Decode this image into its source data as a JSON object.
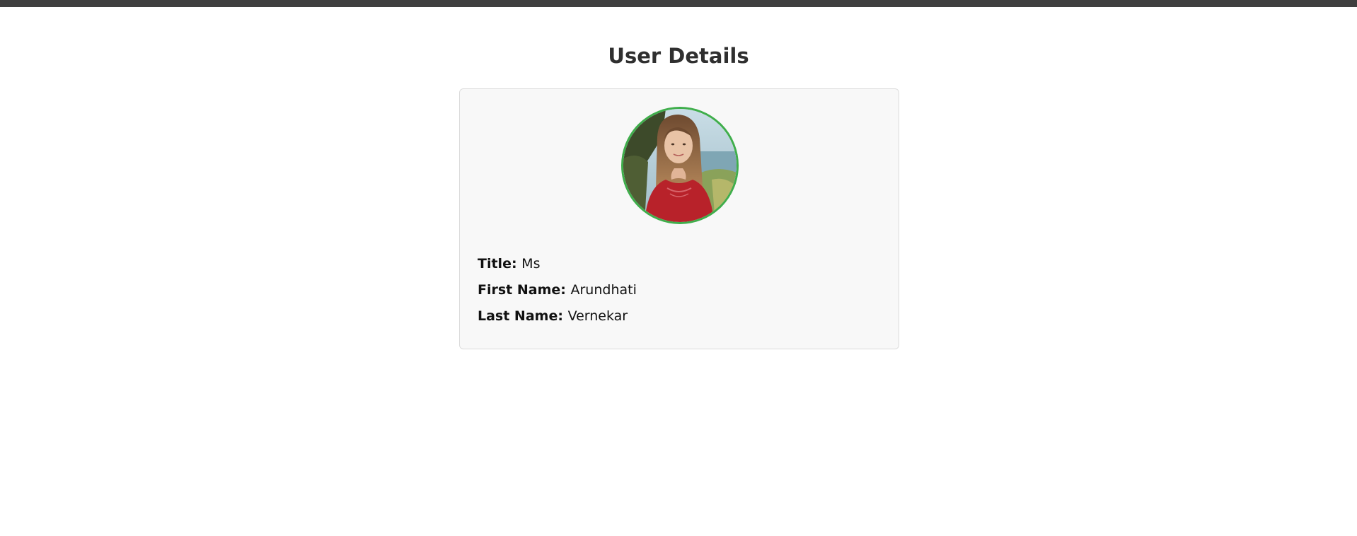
{
  "page": {
    "title": "User Details"
  },
  "user": {
    "avatar": {
      "icon": "user-photo",
      "border_color": "#3fae4b"
    },
    "fields": [
      {
        "label": "Title:",
        "value": "Ms"
      },
      {
        "label": "First Name:",
        "value": "Arundhati"
      },
      {
        "label": "Last Name:",
        "value": "Vernekar"
      }
    ]
  },
  "colors": {
    "top_bar": "#3f3f3f",
    "card_background": "#f8f8f8",
    "card_border": "#dcdcdc",
    "heading": "#2f2f2f"
  }
}
